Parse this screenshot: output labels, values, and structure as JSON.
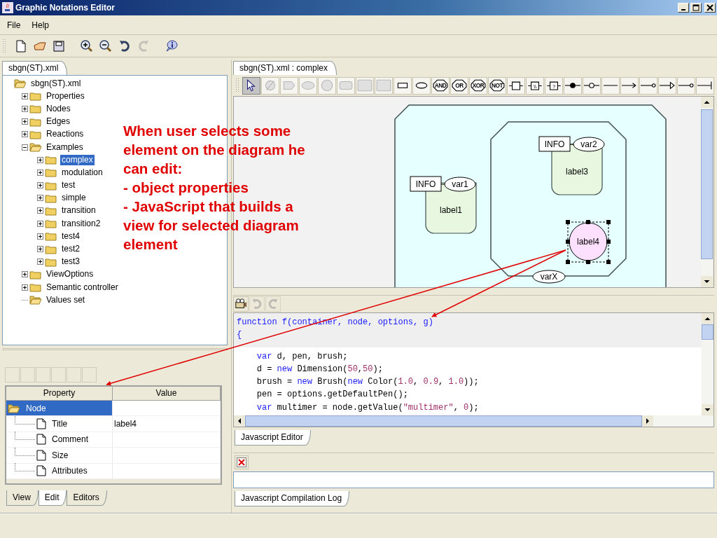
{
  "window": {
    "title": "Graphic Notations Editor"
  },
  "menu": [
    "File",
    "Help"
  ],
  "toolbar": [
    [
      {
        "kind": "new",
        "disabled": false
      },
      {
        "kind": "open",
        "disabled": false
      },
      {
        "kind": "save",
        "disabled": false
      }
    ],
    [
      {
        "kind": "zoom-in",
        "disabled": false
      },
      {
        "kind": "zoom-out",
        "disabled": false
      },
      {
        "kind": "undo",
        "disabled": false
      },
      {
        "kind": "redo",
        "disabled": true
      }
    ],
    [
      {
        "kind": "info",
        "disabled": false
      }
    ]
  ],
  "project_panel": {
    "tabs": [
      {
        "label": "sbgn(ST).xml",
        "selected": true
      }
    ],
    "tree": {
      "label": "sbgn(ST).xml",
      "expanded": true,
      "selected": false,
      "children": [
        {
          "label": "Properties",
          "expanded": false,
          "selected": false
        },
        {
          "label": "Nodes",
          "expanded": false,
          "selected": false
        },
        {
          "label": "Edges",
          "expanded": false,
          "selected": false
        },
        {
          "label": "Reactions",
          "expanded": false,
          "selected": false
        },
        {
          "label": "Examples",
          "expanded": true,
          "selected": false,
          "children": [
            {
              "label": "complex",
              "expanded": false,
              "selected": true
            },
            {
              "label": "modulation",
              "expanded": false,
              "selected": false
            },
            {
              "label": "test",
              "expanded": false,
              "selected": false
            },
            {
              "label": "simple",
              "expanded": false,
              "selected": false
            },
            {
              "label": "transition",
              "expanded": false,
              "selected": false
            },
            {
              "label": "transition2",
              "expanded": false,
              "selected": false
            },
            {
              "label": "test4",
              "expanded": false,
              "selected": false
            },
            {
              "label": "test2",
              "expanded": false,
              "selected": false
            },
            {
              "label": "test3",
              "expanded": false,
              "selected": false
            }
          ]
        },
        {
          "label": "ViewOptions",
          "expanded": false,
          "selected": false
        },
        {
          "label": "Semantic controller",
          "expanded": false,
          "selected": false
        },
        {
          "label": "Values set",
          "expanded": true,
          "selected": false
        }
      ]
    }
  },
  "properties_panel": {
    "columns": [
      "Property",
      "Value"
    ],
    "rows": [
      {
        "label": "Node",
        "selected": true,
        "expanded": true,
        "children": [
          {
            "label": "Title",
            "value": "label4",
            "selected": false
          },
          {
            "label": "Comment",
            "selected": false
          },
          {
            "label": "Size",
            "selected": false
          },
          {
            "label": "Attributes",
            "selected": false
          }
        ]
      }
    ],
    "tabs": [
      {
        "label": "View",
        "selected": false
      },
      {
        "label": "Edit",
        "selected": true
      },
      {
        "label": "Editors",
        "selected": false
      }
    ]
  },
  "diagram_panel": {
    "tabs": [
      {
        "label": "sbgn(ST).xml : complex",
        "selected": true
      }
    ],
    "palette": [
      {
        "kind": "pointer",
        "selected": true,
        "disabled": false
      },
      {
        "kind": "empty-set",
        "selected": false,
        "disabled": true
      },
      {
        "kind": "tag",
        "selected": false,
        "disabled": true
      },
      {
        "kind": "ellipse",
        "selected": false,
        "disabled": true
      },
      {
        "kind": "circle",
        "selected": false,
        "disabled": true
      },
      {
        "kind": "rounded-rect",
        "selected": false,
        "disabled": true
      },
      {
        "kind": "big-rect",
        "selected": false,
        "disabled": true
      },
      {
        "kind": "big-rect",
        "selected": false,
        "disabled": true
      },
      {
        "kind": "small-rect",
        "selected": false,
        "disabled": false
      },
      {
        "kind": "small-ellipse",
        "selected": false,
        "disabled": false
      },
      {
        "kind": "gate",
        "text": "AND",
        "selected": false,
        "disabled": false
      },
      {
        "kind": "gate",
        "text": "OR",
        "selected": false,
        "disabled": false
      },
      {
        "kind": "gate",
        "text": "XOR",
        "selected": false,
        "disabled": false
      },
      {
        "kind": "gate",
        "text": "NOT",
        "selected": false,
        "disabled": false
      },
      {
        "kind": "process",
        "selected": false,
        "disabled": false
      },
      {
        "kind": "process",
        "text": "\\\\",
        "selected": false,
        "disabled": false
      },
      {
        "kind": "process",
        "text": "?",
        "selected": false,
        "disabled": false
      },
      {
        "kind": "dot-line",
        "selected": false,
        "disabled": false
      },
      {
        "kind": "ring-line",
        "selected": false,
        "disabled": false
      },
      {
        "kind": "line",
        "selected": false,
        "disabled": false
      },
      {
        "kind": "arrow-line",
        "selected": false,
        "disabled": false
      },
      {
        "kind": "circle-end-line",
        "selected": false,
        "disabled": false
      },
      {
        "kind": "triangle-line",
        "selected": false,
        "disabled": false
      },
      {
        "kind": "circle-end-line",
        "selected": false,
        "disabled": false
      },
      {
        "kind": "bar-line",
        "selected": false,
        "disabled": false
      }
    ],
    "diagram": {
      "complex_state": "varX",
      "nodes": [
        {
          "kind": "macromolecule",
          "label": "label1",
          "info": "INFO",
          "state": "var1",
          "selected": false
        },
        {
          "kind": "macromolecule",
          "label": "label3",
          "info": "INFO",
          "state": "var2",
          "selected": false
        },
        {
          "kind": "simple-chemical",
          "label": "label4",
          "selected": true
        }
      ]
    }
  },
  "script_panel": {
    "toolbar": [
      {
        "kind": "camera",
        "disabled": false
      },
      {
        "kind": "undo",
        "disabled": true
      },
      {
        "kind": "redo",
        "disabled": true
      }
    ],
    "code": {
      "header": [
        [
          {
            "text": "function f(container, node, options, g)",
            "kind": "keyword"
          }
        ],
        [
          {
            "text": "{",
            "kind": "keyword"
          }
        ]
      ],
      "body": [
        [
          {
            "text": "var",
            "kind": "keyword"
          },
          {
            "text": " d, pen, brush;",
            "kind": "plain"
          }
        ],
        [
          {
            "text": "d = ",
            "kind": "plain"
          },
          {
            "text": "new",
            "kind": "keyword"
          },
          {
            "text": " Dimension(",
            "kind": "plain"
          },
          {
            "text": "50",
            "kind": "number"
          },
          {
            "text": ",",
            "kind": "plain"
          },
          {
            "text": "50",
            "kind": "number"
          },
          {
            "text": ");",
            "kind": "plain"
          }
        ],
        [
          {
            "text": "brush = ",
            "kind": "plain"
          },
          {
            "text": "new",
            "kind": "keyword"
          },
          {
            "text": " Brush(",
            "kind": "plain"
          },
          {
            "text": "new",
            "kind": "keyword"
          },
          {
            "text": " Color(",
            "kind": "plain"
          },
          {
            "text": "1.0",
            "kind": "number"
          },
          {
            "text": ", ",
            "kind": "plain"
          },
          {
            "text": "0.9",
            "kind": "number"
          },
          {
            "text": ", ",
            "kind": "plain"
          },
          {
            "text": "1.0",
            "kind": "number"
          },
          {
            "text": "));",
            "kind": "plain"
          }
        ],
        [
          {
            "text": "pen = options.getDefaultPen();",
            "kind": "plain"
          }
        ],
        [
          {
            "text": "var",
            "kind": "keyword"
          },
          {
            "text": " multimer = node.getValue(",
            "kind": "plain"
          },
          {
            "text": "\"multimer\"",
            "kind": "string"
          },
          {
            "text": ", ",
            "kind": "plain"
          },
          {
            "text": "0",
            "kind": "number"
          },
          {
            "text": ");",
            "kind": "plain"
          }
        ]
      ]
    },
    "tabs": [
      {
        "label": "Javascript Editor",
        "selected": true
      }
    ]
  },
  "log_panel": {
    "tabs": [
      {
        "label": "Javascript Compilation Log",
        "selected": true
      }
    ]
  },
  "annotation": {
    "lines": [
      "When user selects some",
      "element on the diagram he",
      "can edit:",
      "- object properties",
      "- JavaScript that builds a",
      "view for selected diagram",
      "element"
    ]
  }
}
